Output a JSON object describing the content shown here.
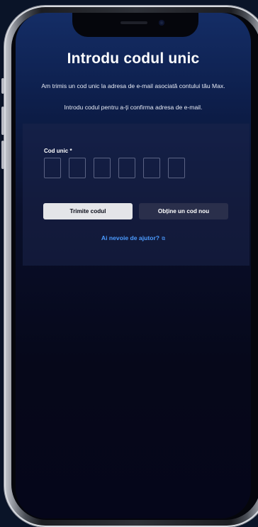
{
  "page": {
    "title": "Introdu codul unic",
    "subtitle": "Am trimis un cod unic la adresa de e-mail asociată contului tău Max.",
    "instruction": "Introdu codul pentru a-ți confirma adresa de e-mail."
  },
  "code_field": {
    "label": "Cod unic *",
    "digits": [
      "",
      "",
      "",
      "",
      "",
      ""
    ]
  },
  "buttons": {
    "submit_label": "Trimite codul",
    "new_code_label": "Obține un cod nou"
  },
  "help_link": {
    "label": "Ai nevoie de ajutor?",
    "icon": "external-link-icon"
  },
  "colors": {
    "accent_link": "#4b9bff",
    "background_top": "#142d66",
    "primary_button": "#e4e5e8",
    "secondary_button": "#2a2f4b"
  }
}
